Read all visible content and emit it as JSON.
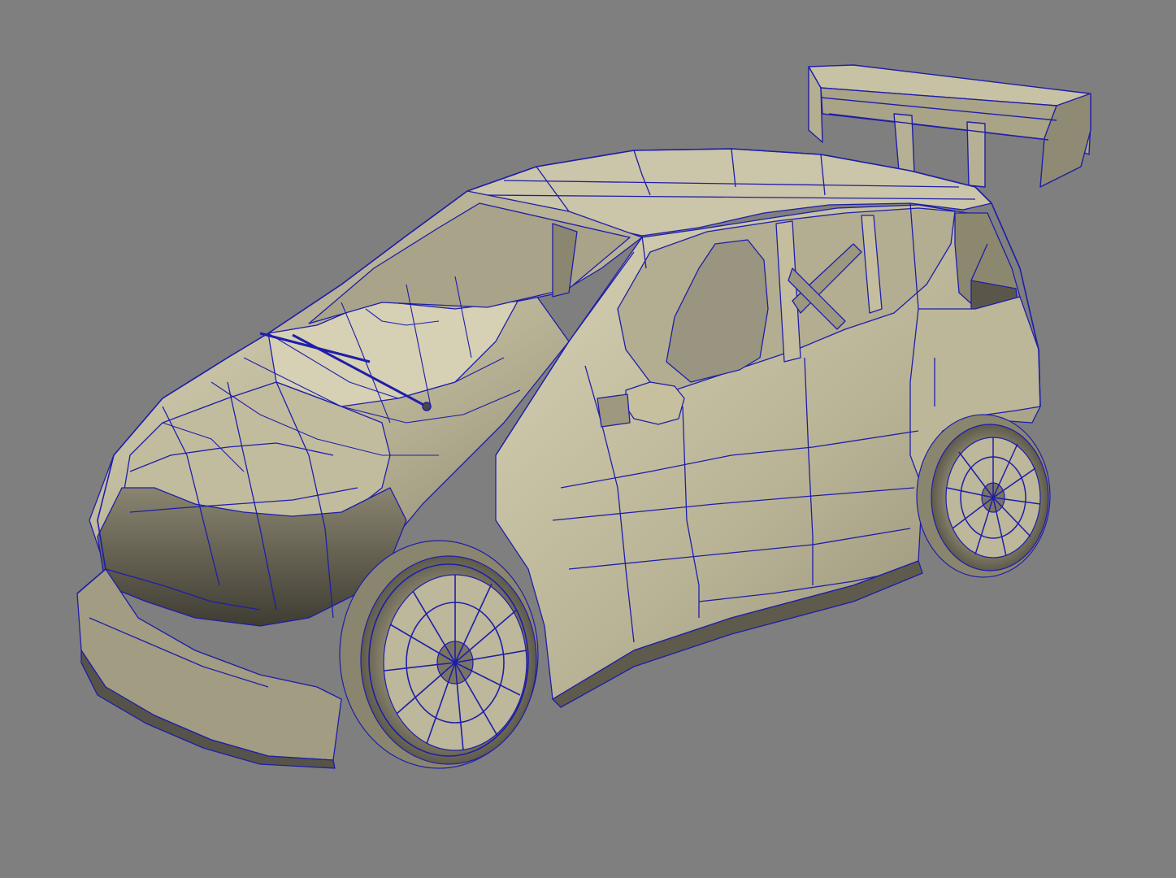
{
  "viewport": {
    "background_color": "#7f7f7f",
    "subject": "car-wireframe-model",
    "shading": "smooth-shaded-with-wireframe-on-shaded"
  },
  "colors": {
    "surface_light": "#c9c3a6",
    "surface_mid": "#a8a287",
    "surface_dark": "#4f4c40",
    "wire": "#1e1ea8"
  },
  "model_parts": [
    "rear-spoiler",
    "roof",
    "windshield",
    "side-windows",
    "roll-cage",
    "hood",
    "wipers",
    "side-mirror",
    "front-bumper",
    "front-splitter",
    "doors",
    "side-skirt",
    "front-wheel",
    "rear-wheel"
  ]
}
